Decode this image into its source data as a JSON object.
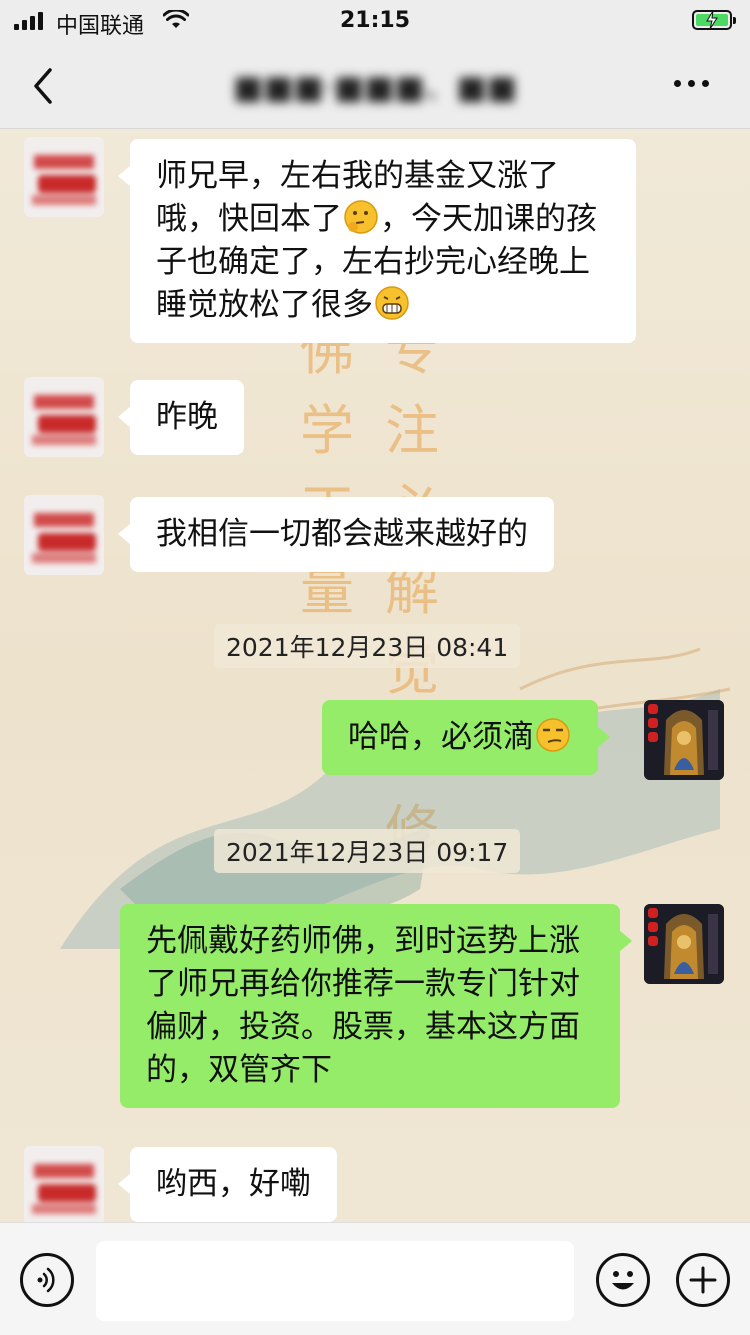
{
  "status_bar": {
    "carrier": "中国联通",
    "time": "21:15",
    "battery_charging": true
  },
  "nav": {
    "title": "■■■·■■■、■■",
    "back_icon": "chevron-left-icon",
    "more_icon": "ellipsis-icon"
  },
  "messages": [
    {
      "side": "left",
      "parts": [
        "师兄早，左右我的基金又涨了哦，快回本了",
        "，今天加课的孩子也确定了，左右抄完心经晚上睡觉放松了很多"
      ],
      "emojis": [
        "thinking-emoji",
        "grin-emoji"
      ]
    },
    {
      "side": "left",
      "text": "昨晚"
    },
    {
      "side": "left",
      "text": "我相信一切都会越来越好的"
    },
    {
      "type": "time",
      "text": "2021年12月23日 08:41"
    },
    {
      "side": "right",
      "text": "哈哈，必须滴",
      "emoji": "smirk-emoji"
    },
    {
      "type": "time",
      "text": "2021年12月23日 09:17"
    },
    {
      "side": "right",
      "text": "先佩戴好药师佛，到时运势上涨了师兄再给你推荐一款专门针对偏财，投资。股票，基本这方面的，双管齐下"
    },
    {
      "side": "left",
      "text": "哟西，好嘞"
    }
  ],
  "input": {
    "voice_icon": "voice-icon",
    "emoji_icon": "emoji-icon",
    "plus_icon": "plus-icon",
    "value": ""
  },
  "colors": {
    "bubble_right": "#95ec69",
    "bubble_left": "#ffffff",
    "nav_bg": "#ededed",
    "chat_bg": "#efe6d3"
  }
}
